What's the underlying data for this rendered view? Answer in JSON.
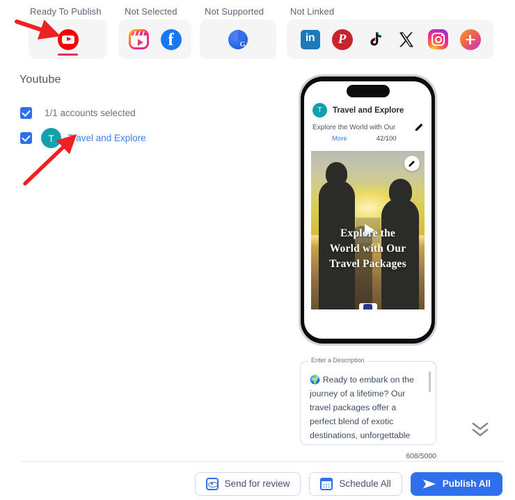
{
  "channel_bar": {
    "groups": [
      {
        "label": "Ready To Publish",
        "icons": [
          {
            "name": "youtube-icon",
            "platform": "YouTube"
          }
        ]
      },
      {
        "label": "Not Selected",
        "icons": [
          {
            "name": "instagram-reels-icon",
            "platform": "Instagram Reels"
          },
          {
            "name": "facebook-icon",
            "platform": "Facebook"
          }
        ]
      },
      {
        "label": "Not Supported",
        "icons": [
          {
            "name": "google-business-icon",
            "platform": "Google Business Profile"
          }
        ]
      },
      {
        "label": "Not Linked",
        "icons": [
          {
            "name": "linkedin-icon",
            "platform": "LinkedIn",
            "glyph": "in"
          },
          {
            "name": "pinterest-icon",
            "platform": "Pinterest"
          },
          {
            "name": "tiktok-icon",
            "platform": "TikTok"
          },
          {
            "name": "x-twitter-icon",
            "platform": "X"
          },
          {
            "name": "instagram-icon",
            "platform": "Instagram"
          },
          {
            "name": "add-account-icon",
            "platform": "Add account"
          }
        ]
      }
    ],
    "active_platform": "YouTube",
    "active_underline_color": "#e0325c"
  },
  "left_panel": {
    "platform_title": "Youtube",
    "accounts_summary": "1/1 accounts selected",
    "accounts": [
      {
        "initial": "T",
        "name": "Travel and Explore",
        "avatar_color": "#12a0ad",
        "checked": true
      }
    ]
  },
  "preview": {
    "account_initial": "T",
    "account_name": "Travel and Explore",
    "post_title": "Explore the World with Our",
    "more_label": "More",
    "title_counter": "42/100",
    "video_overlay_lines": [
      "Explore the",
      "World with Our",
      "Travel Packages"
    ],
    "edit_title_icon": "pencil-icon",
    "edit_media_icon": "pencil-icon",
    "play_icon": "play-icon"
  },
  "description": {
    "legend": "Enter a Description",
    "value": "🌍 Ready to embark on the journey of a lifetime? Our travel packages offer a perfect blend of exotic destinations, unforgettable",
    "counter": "608/5000"
  },
  "expand": {
    "icon": "double-chevron-down-icon"
  },
  "footer": {
    "buttons": [
      {
        "name": "send-for-review-button",
        "label": "Send for review",
        "icon": "eye-icon",
        "style": "outline"
      },
      {
        "name": "schedule-all-button",
        "label": "Schedule All",
        "icon": "calendar-icon",
        "style": "outline"
      },
      {
        "name": "publish-all-button",
        "label": "Publish All",
        "icon": "send-icon",
        "style": "primary"
      }
    ]
  },
  "colors": {
    "primary": "#2f6feb",
    "accent_link": "#3b82f6",
    "annotation": "#ee2222"
  }
}
